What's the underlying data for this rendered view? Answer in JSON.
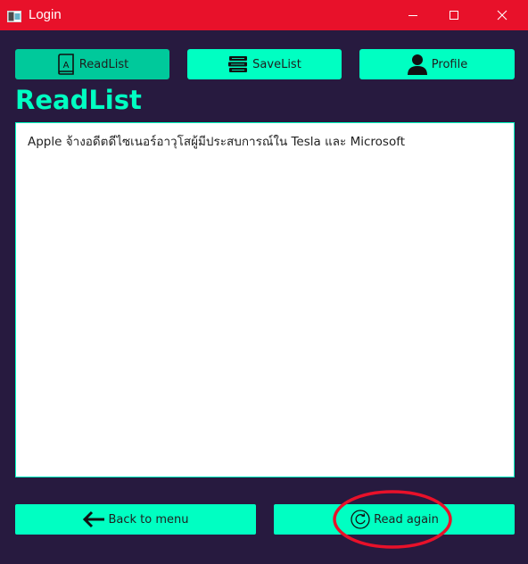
{
  "window": {
    "title": "Login",
    "app_icon": "app-window-icon",
    "controls": [
      "minimize-icon",
      "maximize-icon",
      "close-icon"
    ],
    "titlebar_color": "#e8112a"
  },
  "nav": {
    "items": [
      {
        "label": "ReadList",
        "icon": "book-icon",
        "active": true
      },
      {
        "label": "SaveList",
        "icon": "stacked-books-icon",
        "active": false
      },
      {
        "label": "Profile",
        "icon": "user-icon",
        "active": false
      }
    ]
  },
  "page": {
    "title": "ReadList"
  },
  "content": {
    "text": "Apple จ้างอดีตดีไซเนอร์อาวุโสผู้มีประสบการณ์ใน Tesla และ Microsoft"
  },
  "actions": {
    "back_label": "Back to menu",
    "back_icon": "arrow-left-icon",
    "read_again_label": "Read again",
    "read_again_icon": "refresh-icon"
  },
  "annotation": {
    "highlight": "read-again-button",
    "color": "#e8112a"
  },
  "colors": {
    "background": "#271a3f",
    "accent": "#00ffc2",
    "accent_active": "#00c99b"
  }
}
